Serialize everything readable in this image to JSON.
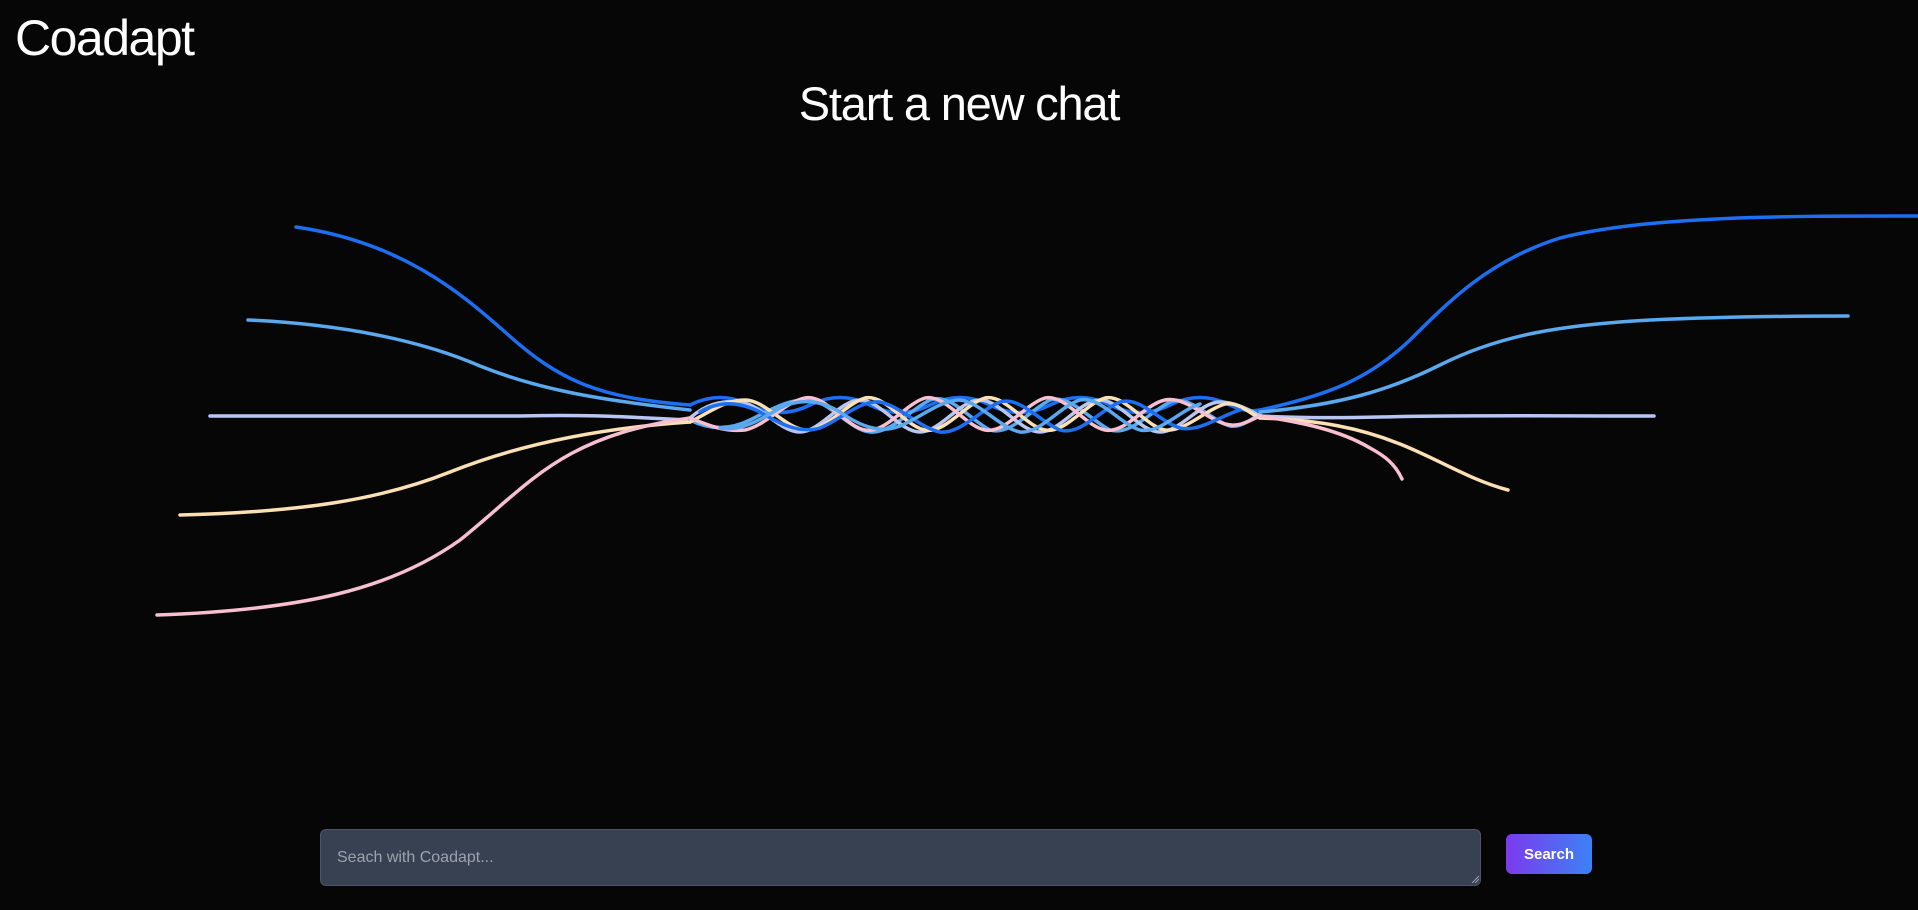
{
  "app": {
    "logo_text": "Coadapt"
  },
  "main": {
    "title": "Start a new chat"
  },
  "search": {
    "placeholder": "Seach with Coadapt...",
    "value": "",
    "button_label": "Search"
  },
  "colors": {
    "background": "#060606",
    "strand_blue_dark": "#1d6ff2",
    "strand_blue_light": "#5aa8ee",
    "strand_lavender": "#b9c6f5",
    "strand_cream": "#fbe0b4",
    "strand_pink": "#f8bfd0",
    "button_gradient_start": "#7c3aed",
    "button_gradient_end": "#3b82f6",
    "input_background": "#374151"
  }
}
